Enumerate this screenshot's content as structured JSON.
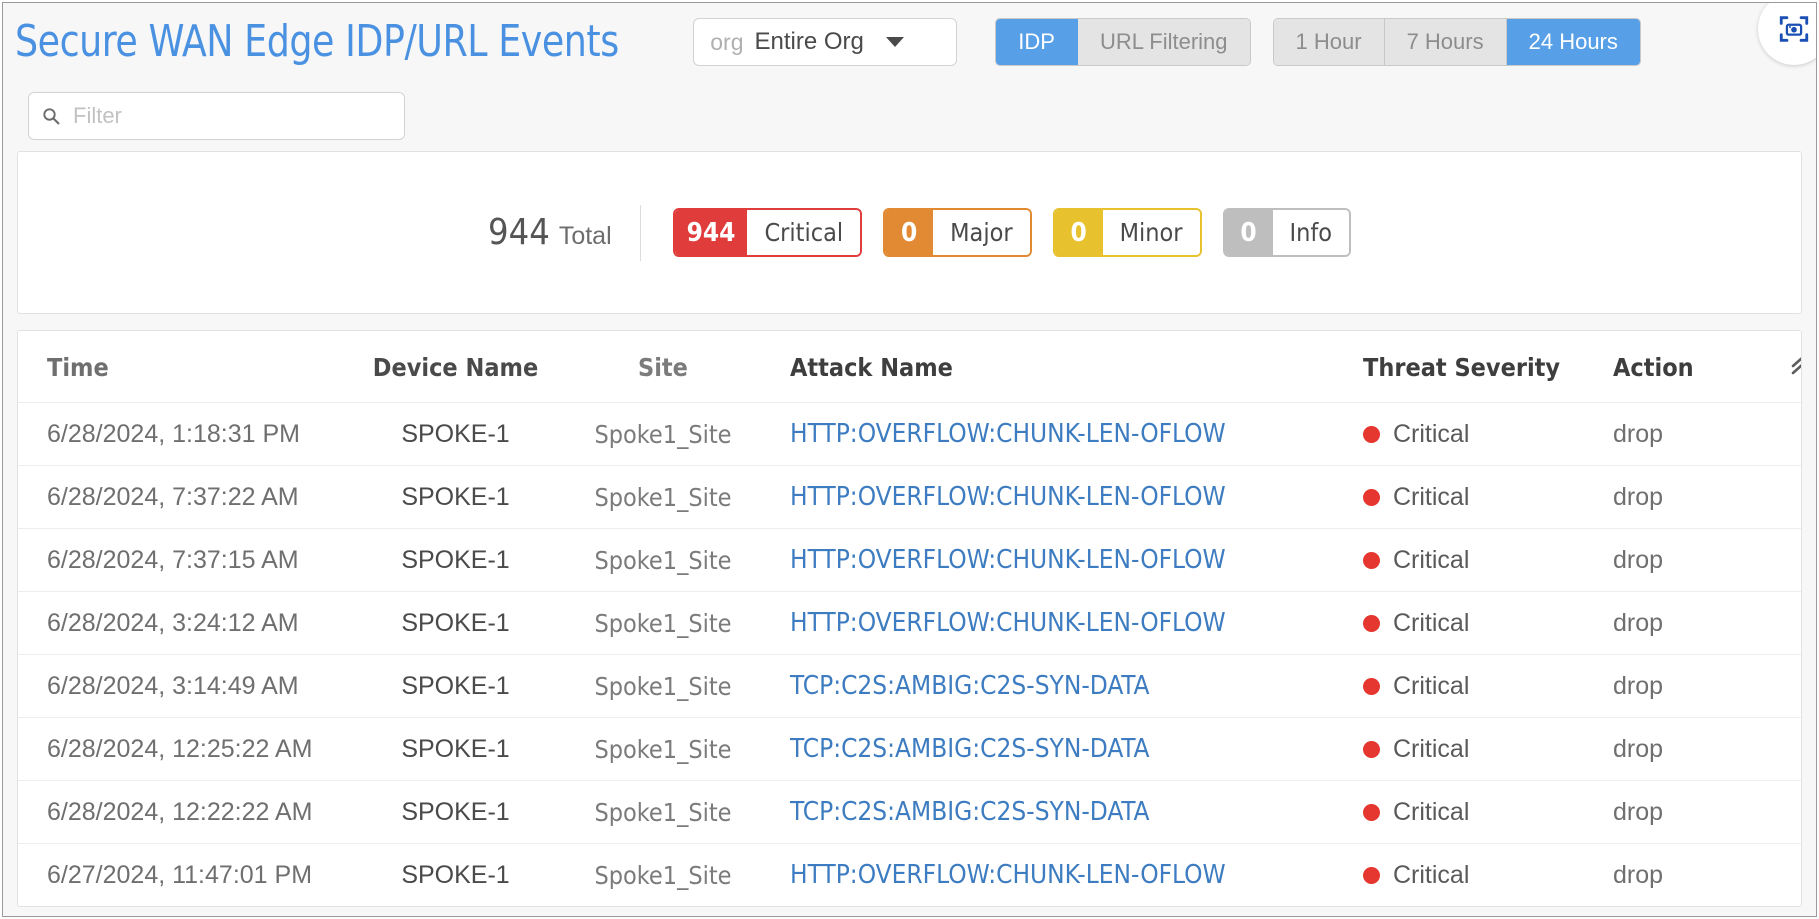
{
  "header": {
    "title": "Secure WAN Edge IDP/URL Events",
    "org_selector": {
      "label": "org",
      "value": "Entire Org",
      "caret_icon": "chevron-down-icon"
    },
    "type_toggle": {
      "options": [
        "IDP",
        "URL Filtering"
      ],
      "selected": "IDP"
    },
    "range_toggle": {
      "options": [
        "1 Hour",
        "7 Hours",
        "24 Hours"
      ],
      "selected": "24 Hours"
    },
    "capture_button": {
      "icon": "screenshot-capture-icon"
    }
  },
  "filter": {
    "icon": "search-icon",
    "placeholder": "Filter",
    "value": ""
  },
  "summary": {
    "total_count": "944",
    "total_label": "Total",
    "badges": [
      {
        "count": "944",
        "label": "Critical",
        "color": "#E13C3C"
      },
      {
        "count": "0",
        "label": "Major",
        "color": "#E28A33"
      },
      {
        "count": "0",
        "label": "Minor",
        "color": "#E7C12E"
      },
      {
        "count": "0",
        "label": "Info",
        "color": "#BEBEBE"
      }
    ]
  },
  "table": {
    "collapse_icon": "chevrons-up-icon",
    "columns": [
      "Time",
      "Device Name",
      "Site",
      "Attack Name",
      "Threat Severity",
      "Action"
    ],
    "severity_colors": {
      "Critical": "#E5362F"
    },
    "rows": [
      {
        "time": "6/28/2024, 1:18:31 PM",
        "device": "SPOKE-1",
        "site": "Spoke1_Site",
        "attack": "HTTP:OVERFLOW:CHUNK-LEN-OFLOW",
        "severity": "Critical",
        "action": "drop"
      },
      {
        "time": "6/28/2024, 7:37:22 AM",
        "device": "SPOKE-1",
        "site": "Spoke1_Site",
        "attack": "HTTP:OVERFLOW:CHUNK-LEN-OFLOW",
        "severity": "Critical",
        "action": "drop"
      },
      {
        "time": "6/28/2024, 7:37:15 AM",
        "device": "SPOKE-1",
        "site": "Spoke1_Site",
        "attack": "HTTP:OVERFLOW:CHUNK-LEN-OFLOW",
        "severity": "Critical",
        "action": "drop"
      },
      {
        "time": "6/28/2024, 3:24:12 AM",
        "device": "SPOKE-1",
        "site": "Spoke1_Site",
        "attack": "HTTP:OVERFLOW:CHUNK-LEN-OFLOW",
        "severity": "Critical",
        "action": "drop"
      },
      {
        "time": "6/28/2024, 3:14:49 AM",
        "device": "SPOKE-1",
        "site": "Spoke1_Site",
        "attack": "TCP:C2S:AMBIG:C2S-SYN-DATA",
        "severity": "Critical",
        "action": "drop"
      },
      {
        "time": "6/28/2024, 12:25:22 AM",
        "device": "SPOKE-1",
        "site": "Spoke1_Site",
        "attack": "TCP:C2S:AMBIG:C2S-SYN-DATA",
        "severity": "Critical",
        "action": "drop"
      },
      {
        "time": "6/28/2024, 12:22:22 AM",
        "device": "SPOKE-1",
        "site": "Spoke1_Site",
        "attack": "TCP:C2S:AMBIG:C2S-SYN-DATA",
        "severity": "Critical",
        "action": "drop"
      },
      {
        "time": "6/27/2024, 11:47:01 PM",
        "device": "SPOKE-1",
        "site": "Spoke1_Site",
        "attack": "HTTP:OVERFLOW:CHUNK-LEN-OFLOW",
        "severity": "Critical",
        "action": "drop"
      }
    ]
  }
}
